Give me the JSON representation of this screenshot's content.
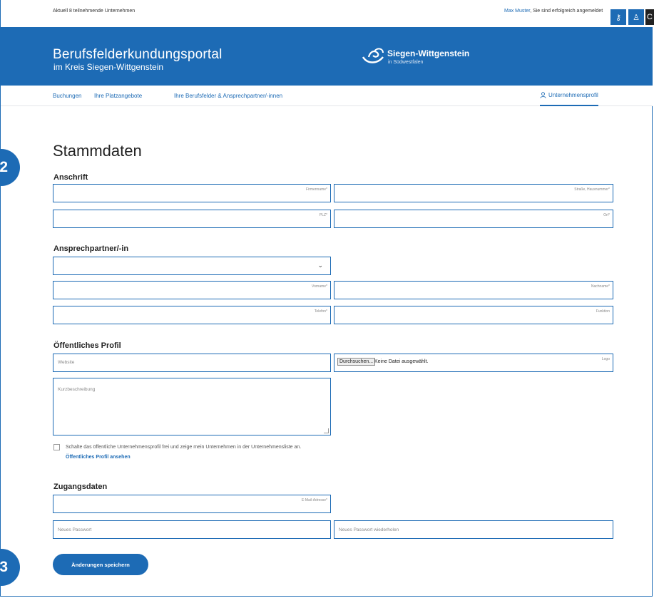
{
  "topbar": {
    "info": "Aktuell 8 teilnehmende Unternehmen",
    "user_name": "Max Muster",
    "login_status": ", Sie sind erfolgreich angemeldet",
    "buttons": [
      {
        "icon": "key-icon",
        "glyph": "⚷"
      },
      {
        "icon": "user-icon",
        "glyph": "♙"
      },
      {
        "icon": "power-icon",
        "glyph": "C"
      }
    ]
  },
  "header": {
    "title": "Berufsfelderkundungsportal",
    "subtitle": "im Kreis Siegen-Wittgenstein",
    "logo_text": "Siegen-Wittgenstein",
    "logo_sub": "in Südwestfalen"
  },
  "nav": {
    "items": [
      "Buchungen",
      "Ihre Platzangebote",
      "Ihre Berufsfelder & Ansprechpartner/-innen"
    ],
    "profile": "Unternehmensprofil"
  },
  "badges": [
    "2",
    "3"
  ],
  "page": {
    "title": "Stammdaten"
  },
  "anschrift": {
    "heading": "Anschrift",
    "fields": [
      "Firmenname*",
      "Straße, Hausnummer*",
      "PLZ*",
      "Ort*"
    ]
  },
  "ansprechpartner": {
    "heading": "Ansprechpartner/-in",
    "select_value": "",
    "fields": [
      "Vorname*",
      "Nachname*",
      "Telefon*",
      "Funktion"
    ]
  },
  "profil": {
    "heading": "Öffentliches Profil",
    "website_placeholder": "Website",
    "file_button": "Durchsuchen...",
    "file_text": "Keine Datei ausgewählt.",
    "logo_label": "Logo",
    "description_placeholder": "Kurzbeschreibung",
    "checkbox_text": "Schalte das öffentliche Unternehmensprofil frei und zeige mein Unternehmen in der Unternehmensliste an.",
    "checkbox_checked": false,
    "link": "Öffentliches Profil ansehen"
  },
  "zugang": {
    "heading": "Zugangsdaten",
    "email_label": "E-Mail-Adresse*",
    "password_placeholder": "Neues Passwort",
    "password_repeat_placeholder": "Neues Passwort wiederholen"
  },
  "save_label": "Änderungen speichern",
  "colors": {
    "brand": "#1d6bb5"
  }
}
